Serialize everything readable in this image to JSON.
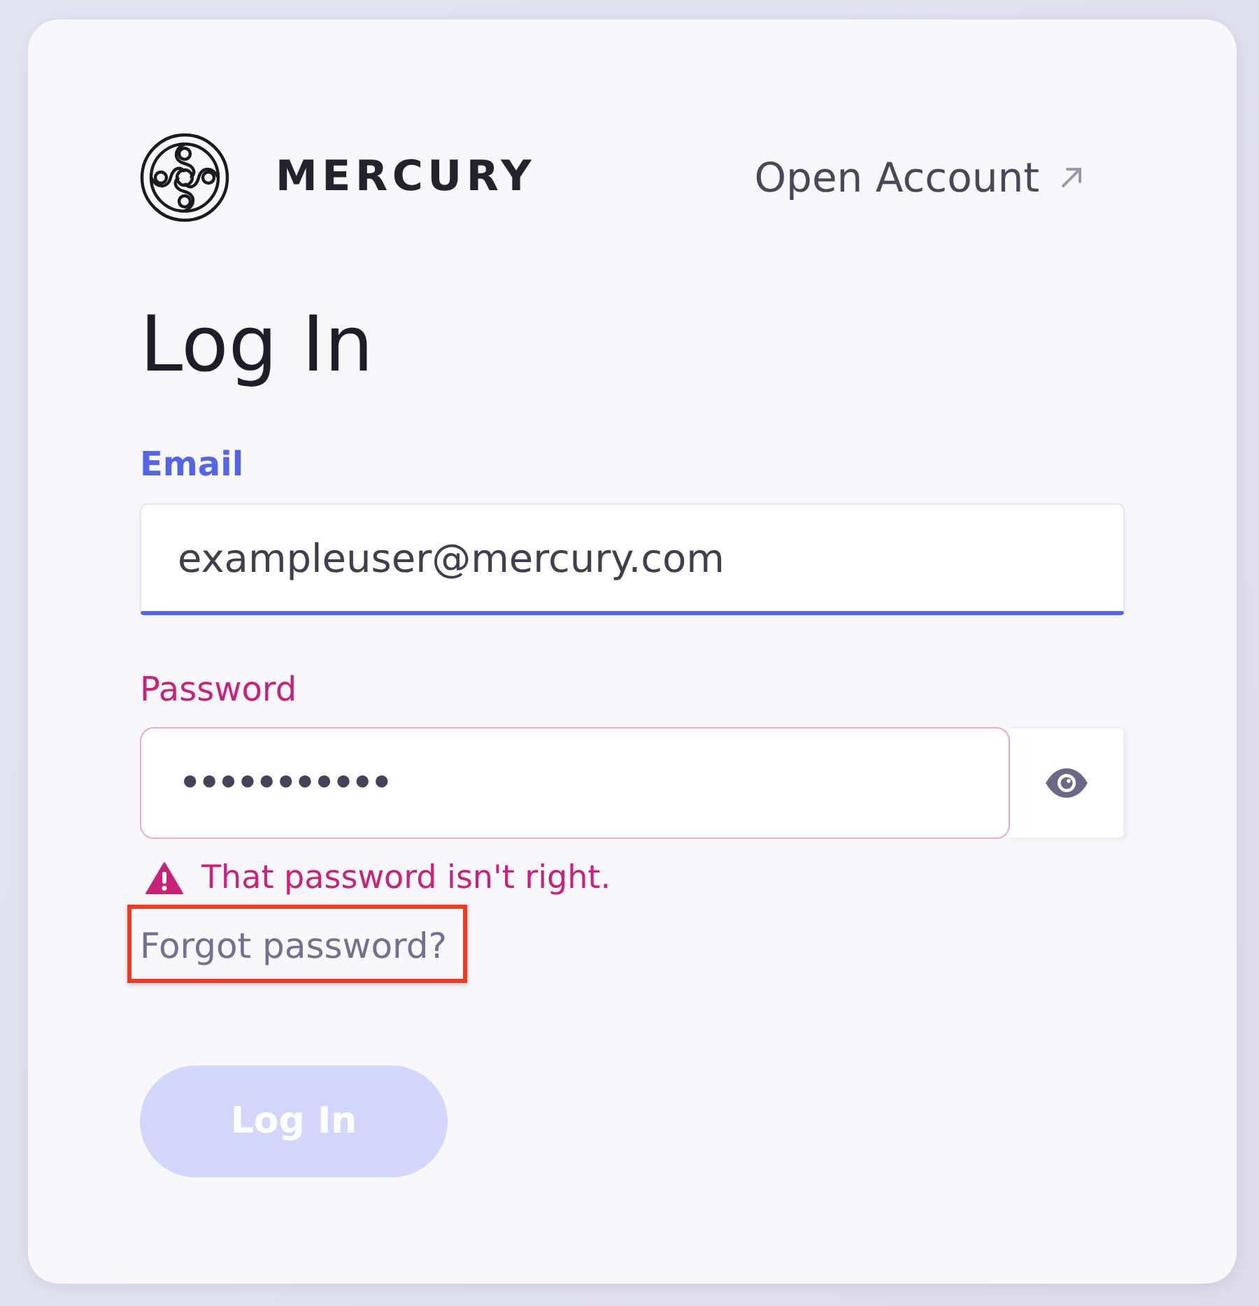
{
  "header": {
    "brand": "MERCURY",
    "open_account_link": "Open Account"
  },
  "title": "Log In",
  "email": {
    "label": "Email",
    "value": "exampleuser@mercury.com",
    "focused": true
  },
  "password": {
    "label": "Password",
    "value": "•••••••••••",
    "error": true,
    "error_message": "That password isn't right."
  },
  "forgot_password": {
    "label": "Forgot password?",
    "highlighted": true
  },
  "submit": {
    "label": "Log In",
    "disabled": true
  }
}
